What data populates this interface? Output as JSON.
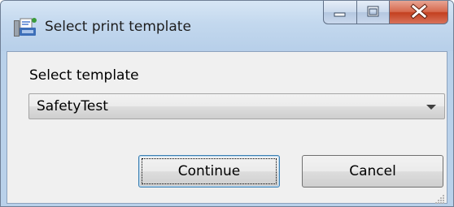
{
  "window": {
    "title": "Select print template",
    "icon": "printer-template-icon",
    "caption_buttons": [
      "minimize-icon",
      "maximize-icon",
      "close-icon"
    ]
  },
  "form": {
    "template_label": "Select template",
    "template_selected": "SafetyTest"
  },
  "buttons": {
    "continue_label": "Continue",
    "cancel_label": "Cancel"
  },
  "colors": {
    "titlebar": "#c3d8ee",
    "client_bg": "#f0f0f0",
    "close_button": "#c3401f",
    "default_button_border": "#3c7fb1"
  }
}
